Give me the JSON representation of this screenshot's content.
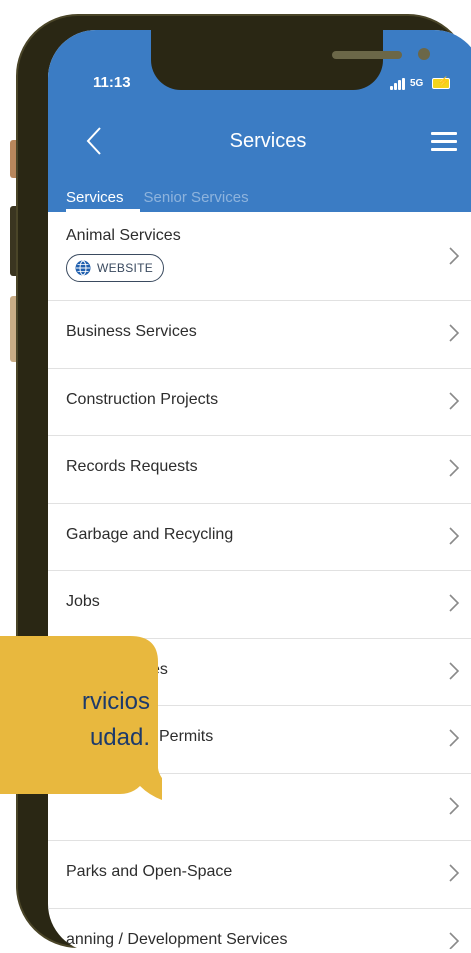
{
  "status_bar": {
    "time": "11:13",
    "network": "5G"
  },
  "header": {
    "title": "Services",
    "back_icon": "chevron-left-icon",
    "menu_icon": "hamburger-menu-icon"
  },
  "tabs": [
    {
      "label": "Services",
      "active": true
    },
    {
      "label": "Senior Services",
      "active": false
    }
  ],
  "services": [
    {
      "label": "Animal Services",
      "button": "WEBSITE"
    },
    {
      "label": "Business Services"
    },
    {
      "label": "Construction Projects"
    },
    {
      "label": "Records Requests"
    },
    {
      "label": "Garbage and Recycling"
    },
    {
      "label": "Jobs"
    },
    {
      "label": "es"
    },
    {
      "label": "Permits"
    },
    {
      "label": ""
    },
    {
      "label": "Parks and Open-Space"
    },
    {
      "label": "anning / Development Services"
    }
  ],
  "overlay": {
    "line1": "rvicios",
    "line2": "udad."
  },
  "colors": {
    "app_bar": "#3b7cc4",
    "phone_frame": "#2a2714",
    "bubble": "#e8b83e",
    "bubble_text": "#1d3a6b"
  }
}
